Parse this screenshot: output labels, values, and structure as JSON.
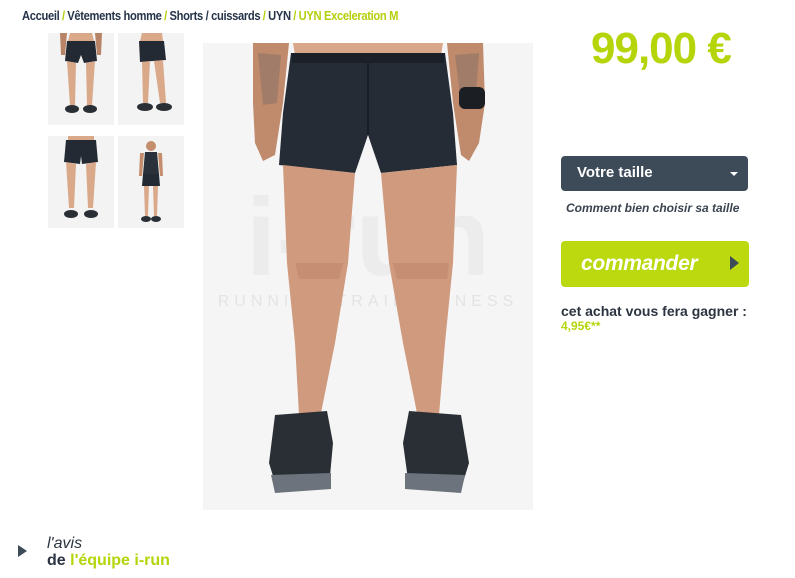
{
  "breadcrumb": {
    "items": [
      "Accueil",
      "Vêtements homme",
      "Shorts / cuissards",
      "UYN"
    ],
    "current": "UYN Exceleration M",
    "separator": "/"
  },
  "thumbnails": [
    {
      "view": "front"
    },
    {
      "view": "side"
    },
    {
      "view": "back"
    },
    {
      "view": "full-body"
    }
  ],
  "product": {
    "image_watermark": "i-run",
    "image_watermark_sub": "RUNNING TRAIL FITNESS",
    "price": "99,00 €"
  },
  "size": {
    "selected": "Votre taille",
    "help_link": "Comment bien choisir sa taille"
  },
  "order": {
    "label": "commander"
  },
  "rewards": {
    "label": "cet achat vous fera gagner :",
    "value": "4,95€**"
  },
  "review": {
    "title": "l'avis",
    "prefix": "de",
    "team": "l'équipe i-run"
  },
  "colors": {
    "accent": "#b5d40a",
    "dark": "#3d4a58"
  }
}
